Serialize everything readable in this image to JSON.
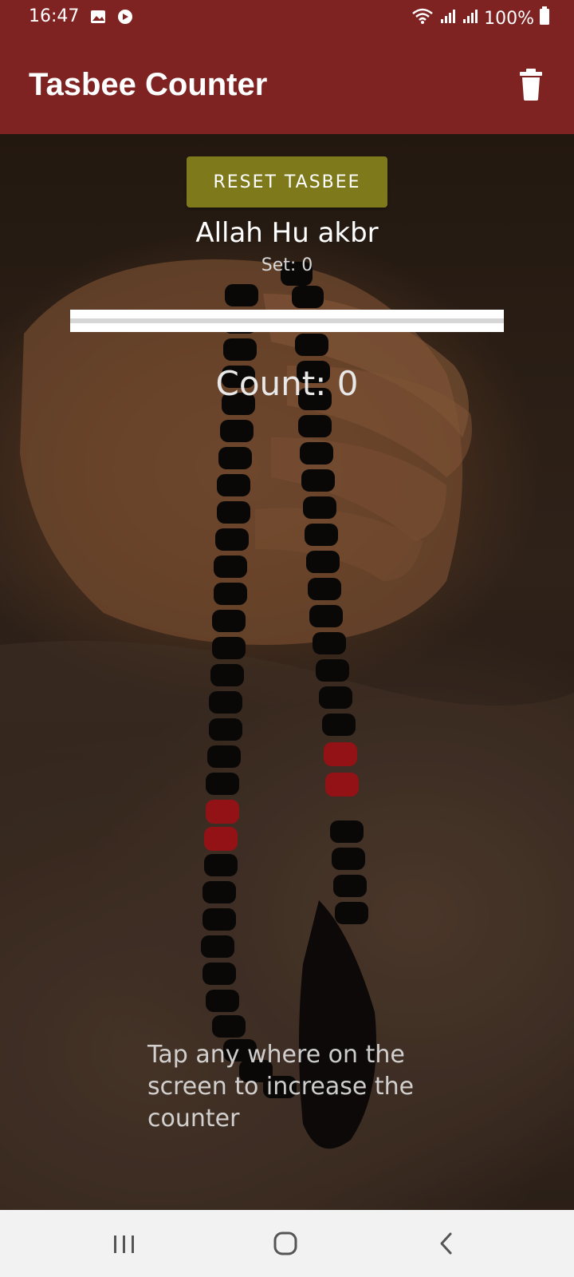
{
  "status_bar": {
    "time": "16:47",
    "battery": "100%",
    "icons": [
      "gallery-icon",
      "app-notification-icon",
      "wifi-icon",
      "signal-icon",
      "signal-icon",
      "battery-icon"
    ]
  },
  "app_bar": {
    "title": "Tasbee Counter",
    "action_icon": "trash-icon"
  },
  "main": {
    "reset_button_label": "RESET TASBEE",
    "dhikr": "Allah Hu akbr",
    "set_label": "Set: 0",
    "progress_fraction": 0,
    "count_label": "Count: 0",
    "hint": "Tap any where on the screen to increase the counter"
  },
  "nav_bar": {
    "buttons": [
      "recent-apps-icon",
      "home-icon",
      "back-icon"
    ]
  },
  "colors": {
    "app_bar": "#7f2222",
    "reset_button": "#7e7a1c",
    "nav_bar": "#f2f2f2"
  }
}
